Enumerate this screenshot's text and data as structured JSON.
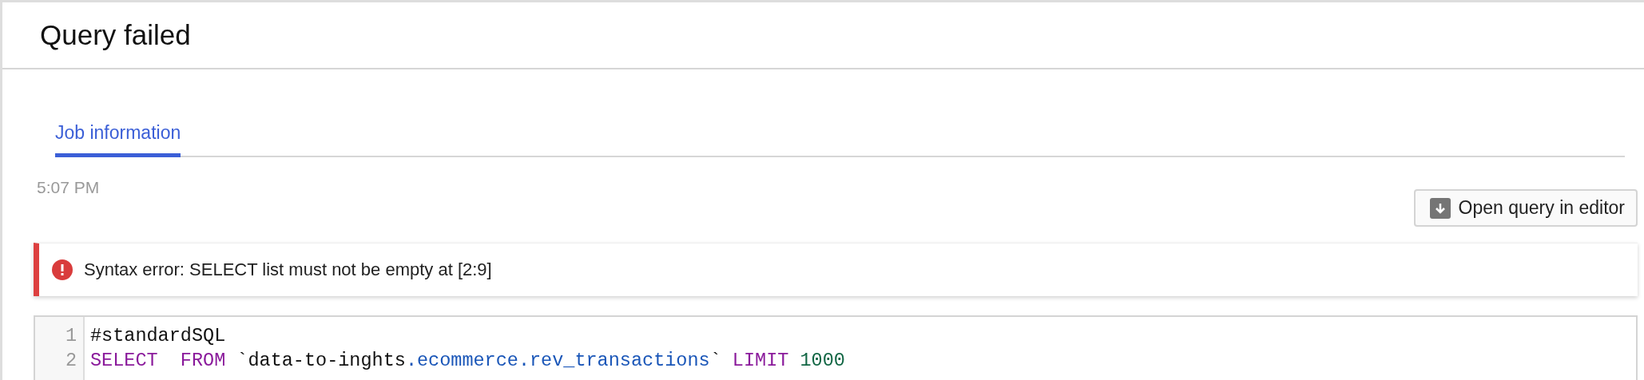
{
  "title": "Query failed",
  "tabs": [
    {
      "label": "Job information",
      "selected": true
    }
  ],
  "time": "5:07 PM",
  "open_button": {
    "label": "Open query in editor"
  },
  "error": {
    "message": "Syntax error: SELECT list must not be empty at [2:9]"
  },
  "code": [
    {
      "number": "1",
      "tokens": [
        {
          "kind": "plain",
          "text": "#standardSQL"
        }
      ]
    },
    {
      "number": "2",
      "tokens": [
        {
          "kind": "keyword",
          "text": "SELECT  FROM"
        },
        {
          "kind": "plain",
          "text": " `data-to-inghts"
        },
        {
          "kind": "identifier",
          "text": ".ecommerce.rev_transactions"
        },
        {
          "kind": "plain",
          "text": "` "
        },
        {
          "kind": "keyword",
          "text": "LIMIT"
        },
        {
          "kind": "number",
          "text": " 1000"
        }
      ]
    }
  ]
}
